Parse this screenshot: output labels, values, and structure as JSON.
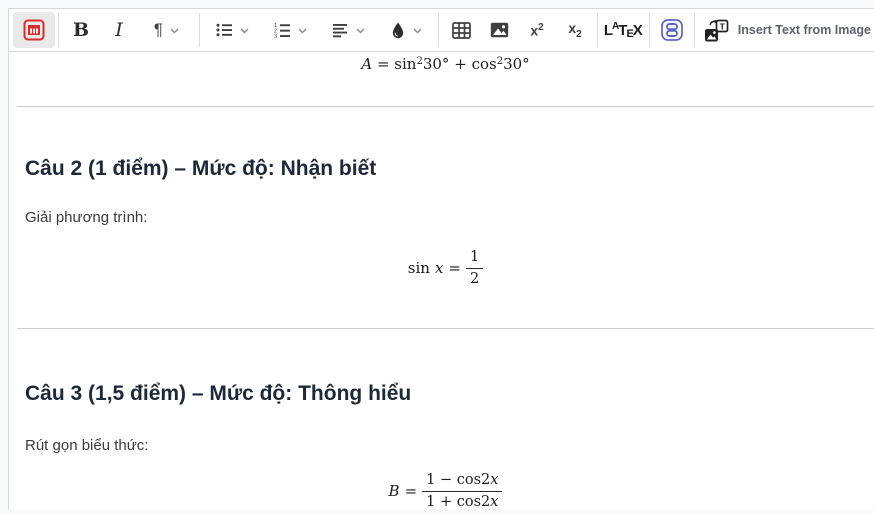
{
  "toolbar": {
    "bold_label": "B",
    "italic_label": "I",
    "paragraph_label": "¶",
    "superscript": {
      "base": "x",
      "script": "2"
    },
    "subscript": {
      "base": "x",
      "script": "2"
    },
    "latex": {
      "l": "L",
      "a": "A",
      "t": "T",
      "e": "E",
      "x": "X"
    },
    "insert_text_label": "Insert Text from Image",
    "icons": {
      "formula_editor": "matrix-formula-icon",
      "lists": [
        "bullet-list-icon",
        "numbered-list-icon"
      ],
      "align": "align-left-icon",
      "color": "ink-drop-icon",
      "insert": [
        "table-icon",
        "image-icon"
      ],
      "matrix_block": "stacked-blocks-icon",
      "ocr": "image-to-text-icon"
    }
  },
  "document": {
    "formula_a": {
      "lhs": "A",
      "eq": "=",
      "sin": "sin",
      "sup": "2",
      "angle": "30",
      "deg": "°",
      "plus": "+",
      "cos": "cos"
    },
    "sections": [
      {
        "heading": "Câu 2 (1 điểm) – Mức độ: Nhận biết",
        "prompt": "Giải phương trình:"
      },
      {
        "heading": "Câu 3 (1,5 điểm) – Mức độ: Thông hiểu",
        "prompt": "Rút gọn biểu thức:"
      }
    ],
    "formula_sin": {
      "fn": "sin",
      "var": "x",
      "eq": "=",
      "num": "1",
      "den": "2"
    },
    "formula_b": {
      "lhs": "B",
      "eq": "=",
      "num_pre": "1 − cos2",
      "num_var": "x",
      "den_pre": "1 + cos2",
      "den_var": "x"
    }
  },
  "colors": {
    "accent_red": "#d92b2b",
    "accent_indigo": "#5b67c7",
    "heading_text": "#1d2939",
    "divider": "#d8d8d8"
  }
}
